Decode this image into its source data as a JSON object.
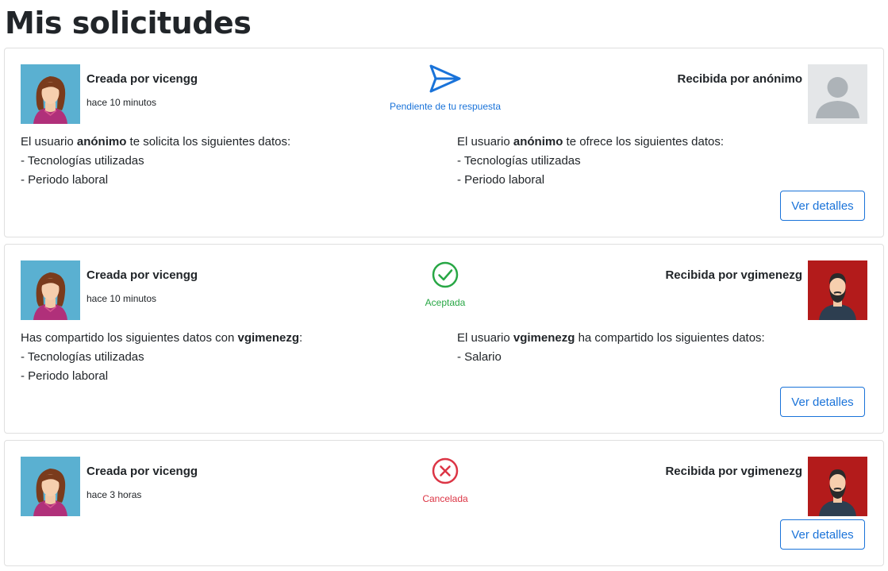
{
  "page": {
    "title": "Mis solicitudes"
  },
  "colors": {
    "pending": "#1a73d9",
    "accepted": "#28a745",
    "cancelled": "#dc3545",
    "red_avatar_bg": "#b31b1b",
    "blue_avatar_bg": "#5ab0d1"
  },
  "requests": [
    {
      "creator": "Creada por vicengg",
      "time": "hace 10 minutos",
      "receiver": "Recibida por anónimo",
      "status_icon": "paper-plane-icon",
      "status": "Pendiente de tu respuesta",
      "left": {
        "prefix": "El usuario ",
        "user": "anónimo",
        "suffix": " te solicita los siguientes datos:",
        "items": [
          "- Tecnologías utilizadas",
          "- Periodo laboral"
        ]
      },
      "right": {
        "prefix": "El usuario ",
        "user": "anónimo",
        "suffix": " te ofrece los siguientes datos:",
        "items": [
          "- Tecnologías utilizadas",
          "- Periodo laboral"
        ]
      },
      "button": "Ver detalles"
    },
    {
      "creator": "Creada por vicengg",
      "time": "hace 10 minutos",
      "receiver": "Recibida por vgimenezg",
      "status_icon": "check-circle-icon",
      "status": "Aceptada",
      "left": {
        "prefix": "Has compartido los siguientes datos con ",
        "user": "vgimenezg",
        "suffix": ":",
        "items": [
          "- Tecnologías utilizadas",
          "- Periodo laboral"
        ]
      },
      "right": {
        "prefix": "El usuario ",
        "user": "vgimenezg",
        "suffix": " ha compartido los siguientes datos:",
        "items": [
          "- Salario"
        ]
      },
      "button": "Ver detalles"
    },
    {
      "creator": "Creada por vicengg",
      "time": "hace 3 horas",
      "receiver": "Recibida por vgimenezg",
      "status_icon": "x-circle-icon",
      "status": "Cancelada",
      "button": "Ver detalles"
    }
  ]
}
